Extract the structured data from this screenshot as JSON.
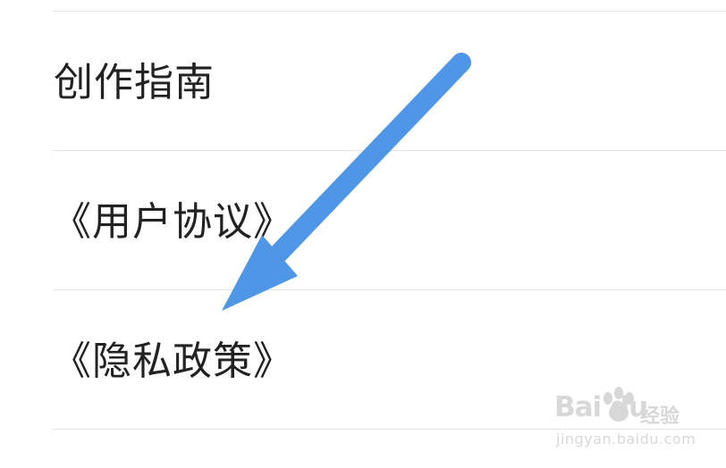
{
  "menu": {
    "items": [
      {
        "label": "创作指南"
      },
      {
        "label": "《用户协议》"
      },
      {
        "label": "《隐私政策》"
      }
    ]
  },
  "annotation": {
    "arrow_color": "#5096E6"
  },
  "watermark": {
    "brand": "Bai du",
    "product": "经验",
    "url": "jingyan.baidu.com"
  }
}
